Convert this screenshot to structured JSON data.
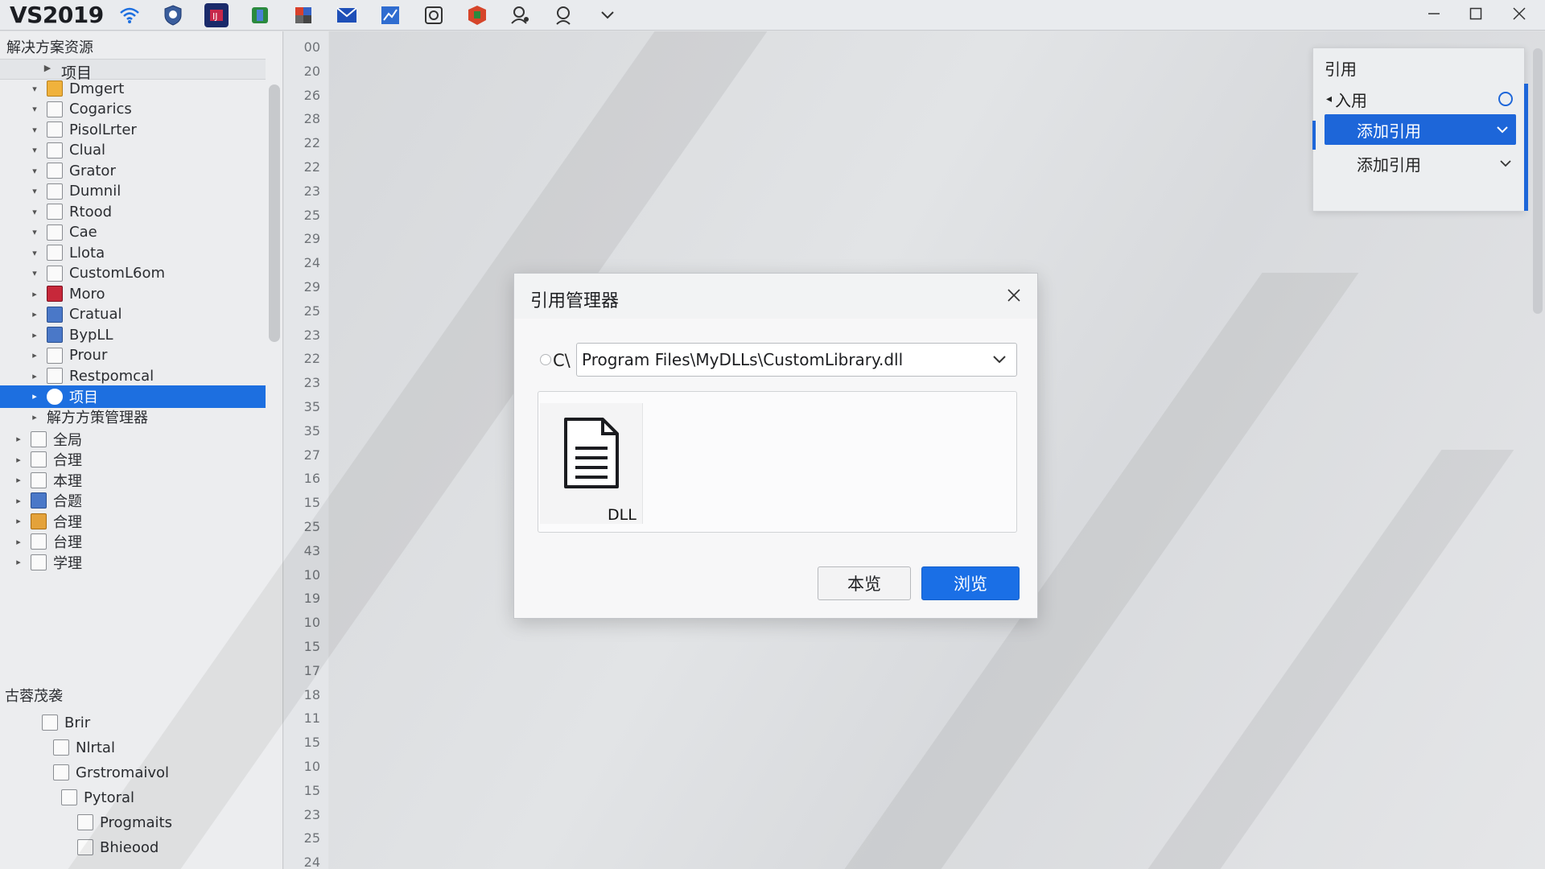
{
  "app": {
    "title": "VS2019",
    "toolbar_icons": [
      "wifi-icon",
      "shield-icon",
      "ide-icon",
      "map-icon",
      "tools-icon",
      "mail-icon",
      "chart-icon",
      "camera-icon",
      "puzzle-icon",
      "user-settings-icon",
      "search-icon",
      "chevron-down-icon"
    ]
  },
  "window_controls": [
    "minimize",
    "maximize",
    "close"
  ],
  "sidebar": {
    "header": "解决方案资源",
    "root_label": "项目",
    "items": [
      {
        "label": "Dmgert",
        "icon": "folder-icon",
        "indent": 1
      },
      {
        "label": "Cogarics",
        "icon": "file-icon",
        "indent": 1
      },
      {
        "label": "PisolLrter",
        "icon": "file-icon",
        "indent": 1
      },
      {
        "label": "Clual",
        "icon": "file-icon",
        "indent": 1
      },
      {
        "label": "Grator",
        "icon": "file-icon",
        "indent": 1
      },
      {
        "label": "Dumnil",
        "icon": "file-icon",
        "indent": 1
      },
      {
        "label": "Rtood",
        "icon": "file-icon",
        "indent": 1
      },
      {
        "label": "Cae",
        "icon": "file-icon",
        "indent": 1
      },
      {
        "label": "Llota",
        "icon": "file-icon",
        "indent": 1
      },
      {
        "label": "CustomL6om",
        "icon": "file-icon",
        "indent": 1
      },
      {
        "label": "Moro",
        "icon": "app-red-icon",
        "indent": 1
      },
      {
        "label": "Cratual",
        "icon": "app-blue-icon",
        "indent": 1
      },
      {
        "label": "BypLL",
        "icon": "app-blue-icon",
        "indent": 1
      },
      {
        "label": "Prour",
        "icon": "file-icon",
        "indent": 1
      },
      {
        "label": "Restpomcal",
        "icon": "file-icon",
        "indent": 1
      },
      {
        "label": "项目",
        "icon": "project-icon",
        "indent": 1,
        "selected": true
      },
      {
        "label": "解方方策管理器",
        "icon": "",
        "indent": 1
      },
      {
        "label": "全局",
        "icon": "file-icon",
        "indent": 0
      },
      {
        "label": "合理",
        "icon": "file-icon",
        "indent": 0
      },
      {
        "label": "本理",
        "icon": "file-icon",
        "indent": 0
      },
      {
        "label": "合题",
        "icon": "app-blue-icon",
        "indent": 0
      },
      {
        "label": "合理",
        "icon": "app-orange-icon",
        "indent": 0
      },
      {
        "label": "台理",
        "icon": "file-icon",
        "indent": 0
      },
      {
        "label": "学理",
        "icon": "file-icon",
        "indent": 0
      }
    ],
    "section2_label": "古蓉茂袭",
    "section2_items": [
      {
        "label": "Brir"
      },
      {
        "label": "Nlrtal"
      },
      {
        "label": "Grstromaivol"
      },
      {
        "label": "Pytoral"
      },
      {
        "label": "Progmaits"
      },
      {
        "label": "Bhieood"
      }
    ]
  },
  "gutter": {
    "line_numbers": [
      "00",
      "20",
      "26",
      "28",
      "22",
      "22",
      "23",
      "25",
      "29",
      "24",
      "29",
      "25",
      "23",
      "22",
      "23",
      "35",
      "35",
      "27",
      "16",
      "15",
      "25",
      "43",
      "10",
      "19",
      "10",
      "15",
      "17",
      "18",
      "11",
      "15",
      "10",
      "15",
      "23",
      "25",
      "24"
    ]
  },
  "reference_panel": {
    "title": "引用",
    "rows": [
      {
        "label": "入用",
        "icon": "circle-icon"
      },
      {
        "label": "添加引用",
        "icon": "chevron-down-icon",
        "active": true
      },
      {
        "label": "添加引用",
        "icon": "chevron-down-icon"
      }
    ]
  },
  "dialog": {
    "title": "引用管理器",
    "path_prefix": "C\\",
    "path_value": "Program Files\\MyDLLs\\CustomLibrary.dll",
    "file_label": "DLL",
    "btn_secondary": "本览",
    "btn_primary": "浏览"
  },
  "colors": {
    "accent": "#1a6fe6",
    "selection": "#1d6fe0"
  }
}
